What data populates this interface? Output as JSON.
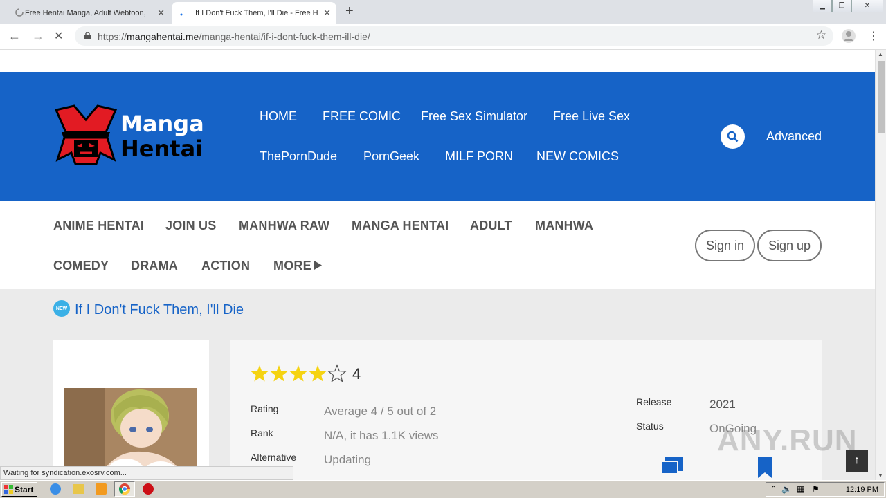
{
  "browser": {
    "tabs": [
      {
        "title": "Free Hentai Manga, Adult Webtoon,",
        "active": false
      },
      {
        "title": "If I Don't Fuck Them, I'll Die - Free H",
        "active": true
      }
    ],
    "url_prefix": "https://",
    "url_host": "mangahentai.me",
    "url_path": "/manga-hentai/if-i-dont-fuck-them-ill-die/",
    "status_text": "Waiting for syndication.exosrv.com..."
  },
  "site": {
    "logo_line1": "Manga",
    "logo_line2": "Hentai",
    "nav_top": [
      "HOME",
      "FREE COMIC",
      "Free Sex Simulator",
      "Free Live Sex"
    ],
    "nav_bottom": [
      "ThePornDude",
      "PornGeek",
      "MILF PORN",
      "NEW COMICS"
    ],
    "advanced": "Advanced",
    "categories_row1": [
      "ANIME HENTAI",
      "JOIN US",
      "MANHWA RAW",
      "MANGA HENTAI",
      "ADULT",
      "MANHWA"
    ],
    "categories_row2": [
      "COMEDY",
      "DRAMA",
      "ACTION",
      "MORE"
    ],
    "sign_in": "Sign in",
    "sign_up": "Sign up"
  },
  "manga": {
    "badge": "NEW",
    "title": "If I Don't Fuck Them, I'll Die",
    "rating_score": "4",
    "stars_filled": 4,
    "stars_total": 5,
    "details": [
      {
        "label": "Rating",
        "value": "Average 4 / 5 out of 2"
      },
      {
        "label": "Rank",
        "value": "N/A, it has 1.1K views"
      },
      {
        "label": "Alternative",
        "value": "Updating"
      }
    ],
    "release_label": "Release",
    "release_value": "2021",
    "status_label": "Status",
    "status_value": "OnGoing"
  },
  "taskbar": {
    "start": "Start",
    "clock": "12:19 PM"
  },
  "watermark": "ANY.RUN",
  "colors": {
    "brand_blue": "#1663c7",
    "logo_red": "#e21b23"
  }
}
